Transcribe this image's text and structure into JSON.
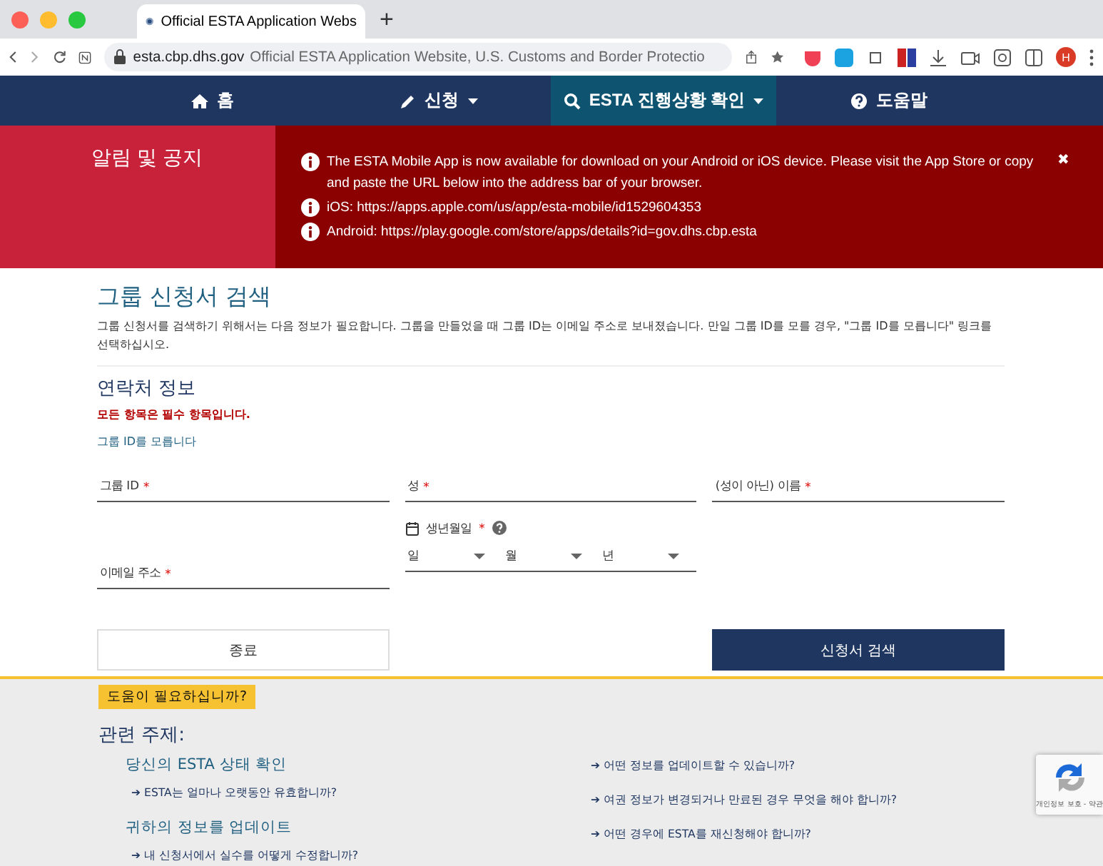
{
  "browser": {
    "tab_title": "Official ESTA Application Webs",
    "new_tab": "+",
    "domain": "esta.cbp.dhs.gov",
    "page_title": "Official ESTA Application Website, U.S. Customs and Border Protectio",
    "avatar": "H"
  },
  "nav": {
    "items": [
      {
        "label": "홈",
        "dropdown": false,
        "selected": false
      },
      {
        "label": "신청",
        "dropdown": true,
        "selected": false
      },
      {
        "label": "ESTA 진행상황 확인",
        "dropdown": true,
        "selected": true
      },
      {
        "label": "도움말",
        "dropdown": false,
        "selected": false
      }
    ]
  },
  "notice": {
    "title": "알림 및 공지",
    "close": "✖",
    "messages": [
      "The ESTA Mobile App is now available for download on your Android or iOS device. Please visit the App Store or copy and paste the URL below into the address bar of your browser.",
      "iOS: https://apps.apple.com/us/app/esta-mobile/id1529604353",
      "Android: https://play.google.com/store/apps/details?id=gov.dhs.cbp.esta"
    ]
  },
  "form": {
    "title": "그룹 신청서 검색",
    "description": "그룹 신청서를 검색하기 위해서는 다음 정보가 필요합니다. 그룹을 만들었을 때 그룹 ID는 이메일 주소로 보내졌습니다. 만일 그룹 ID를 모를 경우, \"그룹 ID를 모릅니다\" 링크를 선택하십시오.",
    "section_title": "연락처 정보",
    "required_note": "모든 항목은 필수 항목입니다.",
    "forgot_link": "그룹 ID를 모릅니다",
    "fields": [
      {
        "kind": "text",
        "label": "그룹 ID",
        "required_mark": "*"
      },
      {
        "kind": "text",
        "label": "성",
        "required_mark": "*"
      },
      {
        "kind": "text",
        "label": "(성이 아닌) 이름",
        "required_mark": "*"
      },
      {
        "kind": "text",
        "label": "이메일 주소",
        "required_mark": "*"
      },
      {
        "kind": "date",
        "label": "생년월일",
        "required_mark": "*",
        "selects": [
          "일",
          "월",
          "년"
        ]
      }
    ],
    "buttons": [
      {
        "kind": "secondary",
        "label": "종료"
      },
      {
        "kind": "primary",
        "label": "신청서 검색"
      }
    ]
  },
  "help": {
    "badge": "도움이 필요하십니까?",
    "title": "관련 주제:",
    "left": [
      {
        "kind": "heading",
        "text": "당신의 ESTA 상태 확인"
      },
      {
        "kind": "link",
        "text": "➔ ESTA는 얼마나 오랫동안 유효합니까?"
      },
      {
        "kind": "heading",
        "text": "귀하의 정보를 업데이트"
      },
      {
        "kind": "link",
        "text": "➔ 내 신청서에서 실수를 어떻게 수정합니까?"
      }
    ],
    "right": [
      {
        "kind": "link",
        "text": "➔ 어떤 정보를 업데이트할 수 있습니까?"
      },
      {
        "kind": "link",
        "text": "➔ 여권 정보가 변경되거나 만료된 경우 무엇을 해야 합니까?"
      },
      {
        "kind": "link",
        "text": "➔ 어떤 경우에 ESTA를 재신청해야 합니까?"
      }
    ],
    "recaptcha": "개인정보 보호 - 약관"
  }
}
